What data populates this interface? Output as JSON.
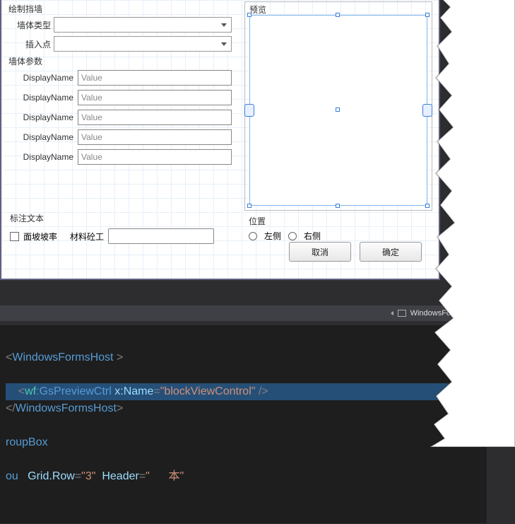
{
  "form": {
    "topSection": "绘制挡墙",
    "wallTypeLabel": "墙体类型",
    "insertPointLabel": "插入点",
    "paramsSection": "墙体参数",
    "params": [
      {
        "label": "DisplayName",
        "value": "Value"
      },
      {
        "label": "DisplayName",
        "value": "Value"
      },
      {
        "label": "DisplayName",
        "value": "Value"
      },
      {
        "label": "DisplayName",
        "value": "Value"
      },
      {
        "label": "DisplayName",
        "value": "Value"
      }
    ],
    "annotSection": "标注文本",
    "slopeCheckbox": "面坡坡率",
    "materialLabel": "材料砼工",
    "previewTitle": "预览",
    "positionTitle": "位置",
    "positionLeft": "左侧",
    "positionRight": "右侧",
    "cancelBtn": "取消",
    "okBtn": "确定"
  },
  "breadcrumb": {
    "host": "WindowsFormsHost"
  },
  "code": {
    "l1_open": "WindowsFormsHost",
    "l2_ns": "wf",
    "l2_elem": "GsPreviewCtrl",
    "l2_attr": "x:Name",
    "l2_val": "blockViewControl",
    "l3_close": "WindowsFormsHost",
    "l4": "roupBox",
    "l5_attr1": "Grid.Row",
    "l5_val1": "3",
    "l5_attr2": "Header",
    "l5_frag": "本"
  }
}
